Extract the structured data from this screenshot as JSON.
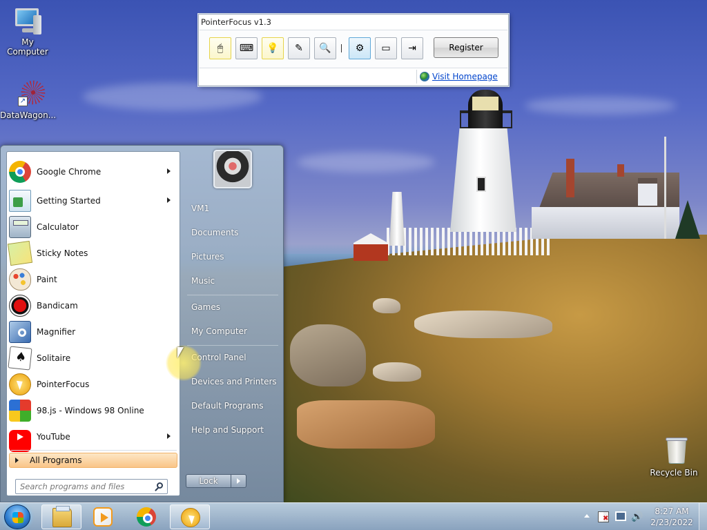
{
  "desktop": {
    "icons": [
      {
        "label": "My Computer",
        "icon": "computer-icon"
      },
      {
        "label": "DataWagon...",
        "icon": "datawagon-icon"
      },
      {
        "label": "Recycle Bin",
        "icon": "recycle-bin-icon"
      }
    ]
  },
  "pointerfocus": {
    "title": "PointerFocus v1.3",
    "toolbar": [
      {
        "name": "mouse-highlight",
        "icon": "mouse-icon",
        "glyph": "🖱"
      },
      {
        "name": "keystroke",
        "icon": "keyboard-icon",
        "glyph": "⌨"
      },
      {
        "name": "spotlight",
        "icon": "lightbulb-icon",
        "glyph": "💡"
      },
      {
        "name": "annotation",
        "icon": "pencil-icon",
        "glyph": "✎"
      },
      {
        "name": "magnifier",
        "icon": "magnifier-icon",
        "glyph": "🔍"
      },
      {
        "name": "settings",
        "icon": "gear-icon",
        "glyph": "⚙"
      },
      {
        "name": "screen",
        "icon": "screen-icon",
        "glyph": "▭"
      },
      {
        "name": "exit",
        "icon": "exit-icon",
        "glyph": "⇥"
      }
    ],
    "separator": "|",
    "register_label": "Register",
    "homepage_link": "Visit Homepage"
  },
  "start_menu": {
    "programs": [
      {
        "label": "Google Chrome",
        "icon": "chrome-icon",
        "has_submenu": true
      },
      {
        "label": "Getting Started",
        "icon": "getting-started-icon",
        "has_submenu": true
      },
      {
        "label": "Calculator",
        "icon": "calculator-icon",
        "has_submenu": false
      },
      {
        "label": "Sticky Notes",
        "icon": "sticky-notes-icon",
        "has_submenu": false
      },
      {
        "label": "Paint",
        "icon": "paint-icon",
        "has_submenu": false
      },
      {
        "label": "Bandicam",
        "icon": "bandicam-icon",
        "has_submenu": false
      },
      {
        "label": "Magnifier",
        "icon": "magnifier-icon",
        "has_submenu": false
      },
      {
        "label": "Solitaire",
        "icon": "solitaire-icon",
        "has_submenu": false
      },
      {
        "label": "PointerFocus",
        "icon": "pointerfocus-icon",
        "has_submenu": false
      },
      {
        "label": "98.js - Windows 98 Online",
        "icon": "windows98-icon",
        "has_submenu": false
      },
      {
        "label": "YouTube",
        "icon": "youtube-icon",
        "has_submenu": true
      }
    ],
    "all_programs_label": "All Programs",
    "search_placeholder": "Search programs and files",
    "right_links": [
      "VM1",
      "Documents",
      "Pictures",
      "Music",
      "Games",
      "My Computer",
      "Control Panel",
      "Devices and Printers",
      "Default Programs",
      "Help and Support"
    ],
    "lock_label": "Lock"
  },
  "taskbar": {
    "buttons": [
      {
        "name": "explorer",
        "icon": "folder-icon",
        "active": true
      },
      {
        "name": "media-player",
        "icon": "media-player-icon",
        "active": false
      },
      {
        "name": "chrome",
        "icon": "chrome-icon",
        "active": false
      },
      {
        "name": "pointerfocus",
        "icon": "pointerfocus-icon",
        "active": true
      }
    ],
    "clock": {
      "time": "8:27 AM",
      "date": "2/23/2022"
    }
  }
}
